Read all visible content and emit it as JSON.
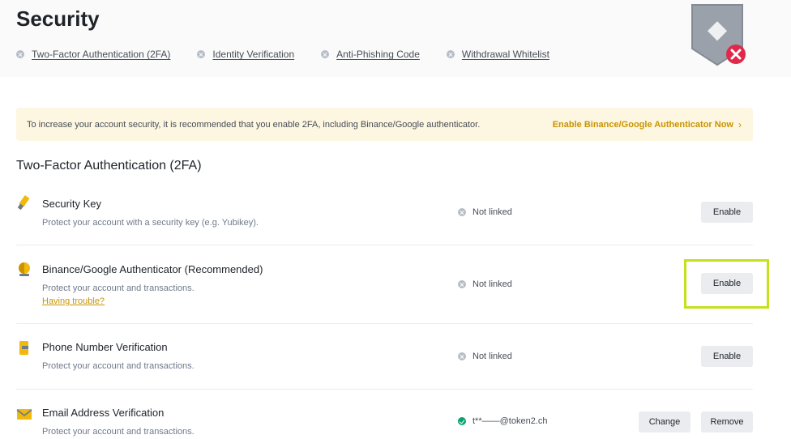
{
  "header": {
    "title": "Security",
    "status_links": [
      {
        "label": "Two-Factor Authentication (2FA)"
      },
      {
        "label": "Identity Verification"
      },
      {
        "label": "Anti-Phishing Code"
      },
      {
        "label": "Withdrawal Whitelist"
      }
    ]
  },
  "banner": {
    "text": "To increase your account security, it is recommended that you enable 2FA, including Binance/Google authenticator.",
    "link": "Enable Binance/Google Authenticator Now",
    "chevron": "›"
  },
  "section": {
    "title": "Two-Factor Authentication (2FA)"
  },
  "rows": [
    {
      "title": "Security Key",
      "desc": "Protect your account with a security key (e.g. Yubikey).",
      "status": "Not linked",
      "button": "Enable",
      "icon": "security-key-icon"
    },
    {
      "title": "Binance/Google Authenticator (Recommended)",
      "desc": "Protect your account and transactions.",
      "trouble": "Having trouble?",
      "status": "Not linked",
      "button": "Enable",
      "icon": "authenticator-icon"
    },
    {
      "title": "Phone Number Verification",
      "desc": "Protect your account and transactions.",
      "status": "Not linked",
      "button": "Enable",
      "icon": "phone-icon"
    },
    {
      "title": "Email Address Verification",
      "desc": "Protect your account and transactions.",
      "status": "t**——@token2.ch",
      "button_change": "Change",
      "button_remove": "Remove",
      "icon": "email-icon"
    }
  ],
  "colors": {
    "accent": "#c99400",
    "banner_bg": "#fdf6e0",
    "highlight": "#c6e01b",
    "error": "#e0294a",
    "success": "#03a66d"
  }
}
